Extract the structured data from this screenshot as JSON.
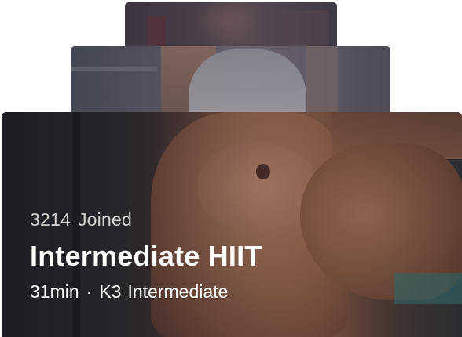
{
  "course_card": {
    "joined_count": "3214",
    "joined_label": "Joined",
    "title": "Intermediate HIIT",
    "duration": "31min",
    "separator": "·",
    "intensity": "K3",
    "level": "Intermediate"
  },
  "colors": {
    "text_primary": "#ffffff",
    "text_secondary": "#d4d1d0",
    "card_dark": "#25262c"
  }
}
